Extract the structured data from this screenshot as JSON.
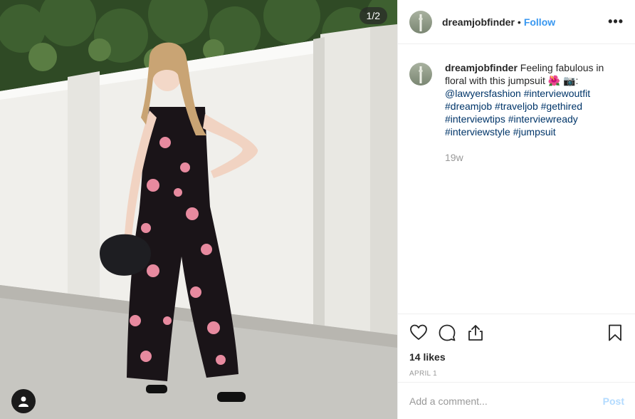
{
  "photo": {
    "counter": "1/2"
  },
  "post": {
    "username": "dreamjobfinder",
    "follow_label": "Follow",
    "separator": "•",
    "more_label": "•••",
    "caption_text": "Feeling fabulous in floral with this jumpsuit 🌺 📷:",
    "mention": "@lawyersfashion",
    "hashtags": [
      "#interviewoutfit",
      "#dreamjob",
      "#traveljob",
      "#gethired",
      "#interviewtips",
      "#interviewready",
      "#interviewstyle",
      "#jumpsuit"
    ],
    "time_ago": "19w",
    "likes": "14 likes",
    "date": "APRIL 1"
  },
  "comment_box": {
    "placeholder": "Add a comment...",
    "post_label": "Post"
  },
  "colors": {
    "link": "#003569",
    "follow": "#3897f0",
    "post_disabled": "#b3dbff",
    "muted": "#999999"
  },
  "icons": [
    "heart-icon",
    "comment-icon",
    "share-icon",
    "bookmark-icon",
    "user-tag-icon",
    "more-icon"
  ]
}
